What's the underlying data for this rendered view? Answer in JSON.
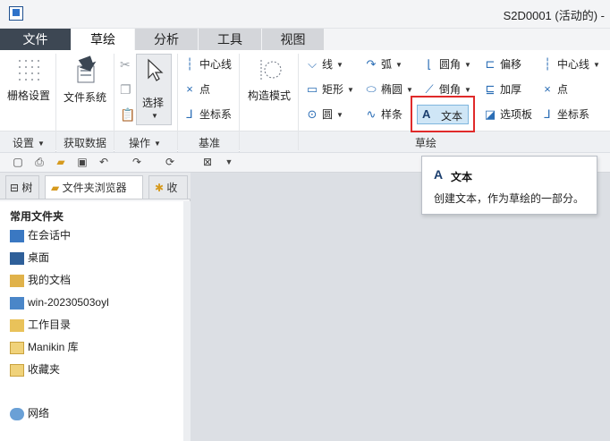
{
  "window": {
    "title": "S2D0001 (活动的) -"
  },
  "tabs": [
    "文件",
    "草绘",
    "分析",
    "工具",
    "视图"
  ],
  "ribbon": {
    "settings": {
      "grid_label": "栅格设置",
      "group": "设置"
    },
    "get_data": {
      "filesystem_label": "文件系统",
      "group": "获取数据"
    },
    "operations": {
      "select_label": "选择",
      "group": "操作"
    },
    "datum": {
      "centerline": "中心线",
      "point": "点",
      "coord": "坐标系",
      "group": "基准"
    },
    "construction": {
      "label": "构造模式"
    },
    "sketch": {
      "line": "线",
      "rectangle": "矩形",
      "circle": "圆",
      "arc": "弧",
      "ellipse": "椭圆",
      "spline": "样条",
      "fillet": "圆角",
      "chamfer": "倒角",
      "text": "文本",
      "offset": "偏移",
      "thicken": "加厚",
      "palette": "选项板",
      "centerline": "中心线",
      "point": "点",
      "coord": "坐标系",
      "group": "草绘"
    }
  },
  "navigator": {
    "tabs": [
      "树",
      "文件夹浏览器",
      "收"
    ],
    "heading": "常用文件夹",
    "items": [
      "在会话中",
      "桌面",
      "我的文档",
      "win-20230503oyl",
      "工作目录",
      "Manikin 库",
      "收藏夹",
      "网络"
    ]
  },
  "tooltip": {
    "title": "文本",
    "description": "创建文本，作为草绘的一部分。"
  }
}
